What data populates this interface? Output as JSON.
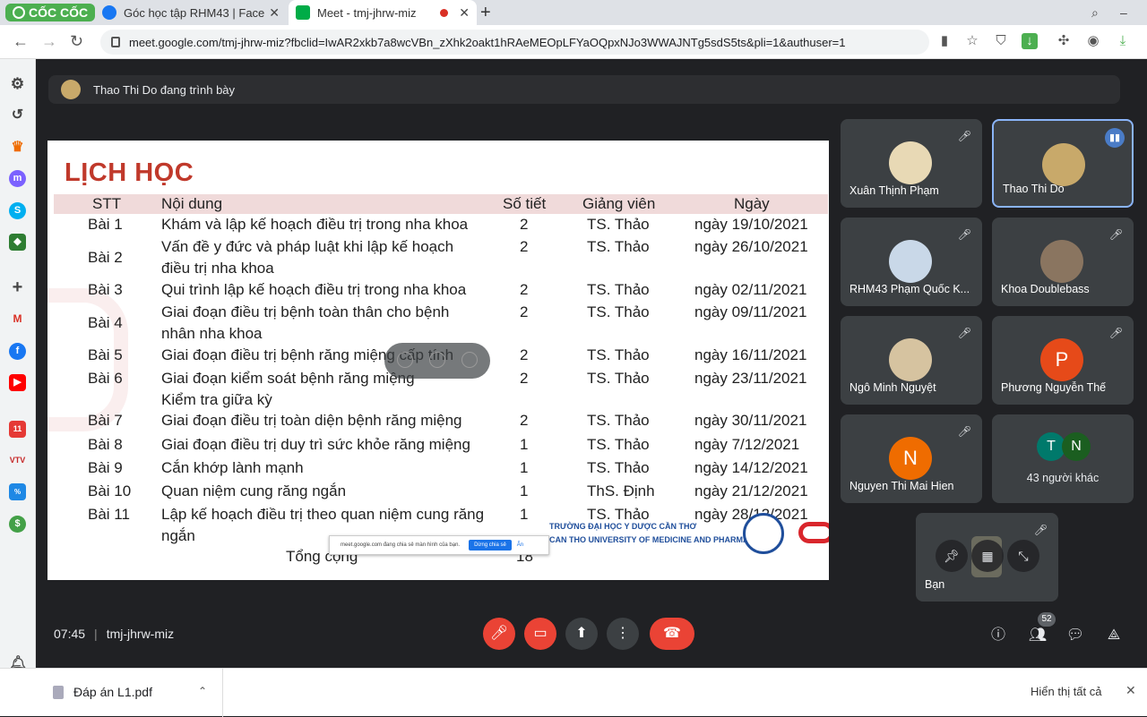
{
  "browser": {
    "brand": "CỐC CỐC",
    "tabs": [
      {
        "title": "Góc học tập RHM43 | Face",
        "favicon_color": "#1877f2",
        "active": false
      },
      {
        "title": "Meet - tmj-jhrw-miz",
        "favicon_color": "#00ac47",
        "active": true
      }
    ],
    "url": "meet.google.com/tmj-jhrw-miz?fbclid=IwAR2xkb7a8wcVBn_zXhk2oakt1hRAeMEOpLFYaOQpxNJo3WWAJNTg5sdS5ts&pli=1&authuser=1",
    "accent": "#4caf50"
  },
  "sidebar": {
    "icons": [
      "gear-icon",
      "history-icon",
      "crown-icon",
      "messenger-icon",
      "skype-icon",
      "game-icon",
      "plus-icon",
      "gmail-icon",
      "facebook-icon",
      "youtube-icon",
      "shop-icon",
      "vtv-icon",
      "sale-icon",
      "wallet-icon",
      "bell-icon"
    ]
  },
  "meet": {
    "presenter_label": "Thao Thi Do đang trình bày",
    "time": "07:45",
    "meeting_code": "tmj-jhrw-miz",
    "participant_count": "52",
    "slide": {
      "title": "LỊCH HỌC",
      "headers": [
        "STT",
        "Nội dung",
        "Số tiết",
        "Giảng viên",
        "Ngày"
      ],
      "rows": [
        {
          "stt": "Bài 1",
          "content": [
            "Khám và lập kế hoạch điều trị trong nha khoa"
          ],
          "hours": "2",
          "lecturer": "TS. Thảo",
          "date": "ngày 19/10/2021"
        },
        {
          "stt": "Bài 2",
          "content": [
            "Vấn đề y đức và pháp luật khi lập kế hoạch",
            "điều trị nha khoa"
          ],
          "hours": "2",
          "lecturer": "TS. Thảo",
          "date": "ngày 26/10/2021"
        },
        {
          "stt": "Bài 3",
          "content": [
            "Qui trình lập kế hoạch điều trị trong nha khoa"
          ],
          "hours": "2",
          "lecturer": "TS. Thảo",
          "date": "ngày 02/11/2021"
        },
        {
          "stt": "Bài 4",
          "content": [
            "Giai đoạn điều trị bệnh toàn thân cho bệnh",
            "nhân nha khoa"
          ],
          "hours": "2",
          "lecturer": "TS. Thảo",
          "date": "ngày 09/11/2021"
        },
        {
          "stt": "Bài 5",
          "content": [
            "Giai đoạn điều trị bệnh răng miệng cấp tính"
          ],
          "hours": "2",
          "lecturer": "TS. Thảo",
          "date": "ngày 16/11/2021"
        },
        {
          "stt": "Bài 6",
          "content": [
            "Giai đoạn kiểm soát bệnh răng miệng",
            "Kiểm tra giữa kỳ"
          ],
          "hours": "2",
          "lecturer": "TS. Thảo",
          "date": "ngày 23/11/2021"
        },
        {
          "stt": "Bài 7",
          "content": [
            "Giai đoạn điều trị toàn diện bệnh răng miệng"
          ],
          "hours": "2",
          "lecturer": "TS. Thảo",
          "date": "ngày 30/11/2021"
        },
        {
          "stt": "Bài 8",
          "content": [
            "Giai đoạn điều trị duy trì sức khỏe răng miệng"
          ],
          "hours": "1",
          "lecturer": "TS. Thảo",
          "date": "ngày 7/12/2021"
        },
        {
          "stt": "Bài 9",
          "content": [
            "Cắn khớp lành mạnh"
          ],
          "hours": "1",
          "lecturer": "TS. Thảo",
          "date": "ngày 14/12/2021"
        },
        {
          "stt": "Bài 10",
          "content": [
            "Quan niệm cung răng ngắn"
          ],
          "hours": "1",
          "lecturer": "ThS. Định",
          "date": "ngày 21/12/2021"
        },
        {
          "stt": "Bài 11",
          "content": [
            "Lập kế hoạch điều trị theo quan niệm cung răng",
            "ngắn"
          ],
          "hours": "1",
          "lecturer": "TS. Thảo",
          "date": "ngày 28/12/2021"
        }
      ],
      "total_label": "Tổng cộng",
      "total_value": "18",
      "school_line1": "TRƯỜNG ĐẠI HỌC Y DƯỢC CẦN THƠ",
      "school_line2": "CAN THO UNIVERSITY OF MEDICINE AND PHARMACY",
      "share_notice": "meet.google.com đang chia sẻ màn hình của bạn.",
      "share_stop": "Dừng chia sẻ",
      "share_hide": "Ẩn"
    },
    "participants": [
      {
        "name": "Xuân Thịnh Phạm",
        "avatar_letter": "",
        "avatar_color": "#e8d9b5",
        "muted": true
      },
      {
        "name": "Thao Thi Do",
        "avatar_letter": "",
        "avatar_color": "#c8a96a",
        "muted": false,
        "speaking": true
      },
      {
        "name": "RHM43 Phạm Quốc K...",
        "avatar_letter": "",
        "avatar_color": "#c9d8e8",
        "muted": true
      },
      {
        "name": "Khoa Doublebass",
        "avatar_letter": "",
        "avatar_color": "#8a7560",
        "muted": true
      },
      {
        "name": "Ngô Minh Nguyệt",
        "avatar_letter": "",
        "avatar_color": "#d6c3a0",
        "muted": true
      },
      {
        "name": "Phương Nguyễn Thế",
        "avatar_letter": "P",
        "avatar_color": "#e64a19",
        "muted": true
      },
      {
        "name": "Nguyen Thi Mai Hien",
        "avatar_letter": "N",
        "avatar_color": "#ef6c00",
        "muted": true
      }
    ],
    "others": {
      "label": "43 người khác",
      "avatars": [
        "T",
        "N"
      ],
      "colors": [
        "#00796b",
        "#1b5e20"
      ]
    },
    "self": {
      "name": "Bạn",
      "muted": true
    }
  },
  "downloads": {
    "file": "Đáp án L1.pdf",
    "show_all": "Hiển thị tất cả"
  }
}
